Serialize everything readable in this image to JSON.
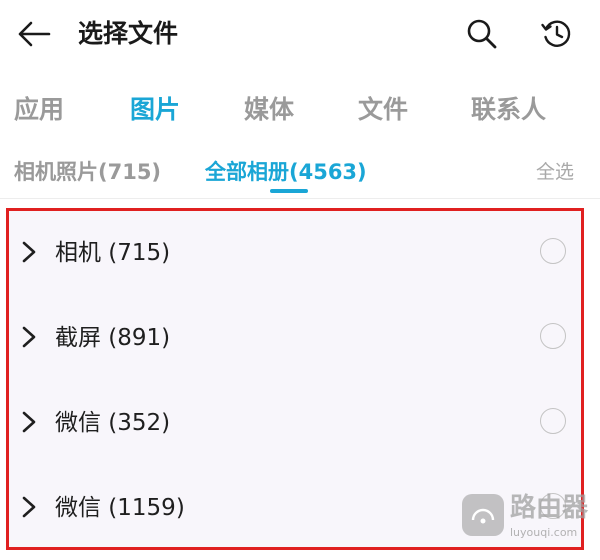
{
  "header": {
    "title": "选择文件",
    "back_icon": "arrow-left-icon",
    "search_icon": "search-icon",
    "history_icon": "history-clock-icon"
  },
  "tabs": [
    {
      "label": "应用",
      "active": false
    },
    {
      "label": "图片",
      "active": true
    },
    {
      "label": "媒体",
      "active": false
    },
    {
      "label": "文件",
      "active": false
    },
    {
      "label": "联系人",
      "active": false
    }
  ],
  "subtabs": [
    {
      "label": "相机照片(715)",
      "active": false
    },
    {
      "label": "全部相册(4563)",
      "active": true
    }
  ],
  "select_all_label": "全选",
  "albums": [
    {
      "label": "相机 (715)",
      "selected": false
    },
    {
      "label": "截屏 (891)",
      "selected": false
    },
    {
      "label": "微信 (352)",
      "selected": false
    },
    {
      "label": "微信 (1159)",
      "selected": false
    }
  ],
  "watermark": {
    "text": "路由器",
    "url": "luyouqi.com"
  },
  "colors": {
    "accent": "#1aa6d6",
    "highlight_border": "#e02020",
    "inactive_text": "#9a9a9a"
  }
}
